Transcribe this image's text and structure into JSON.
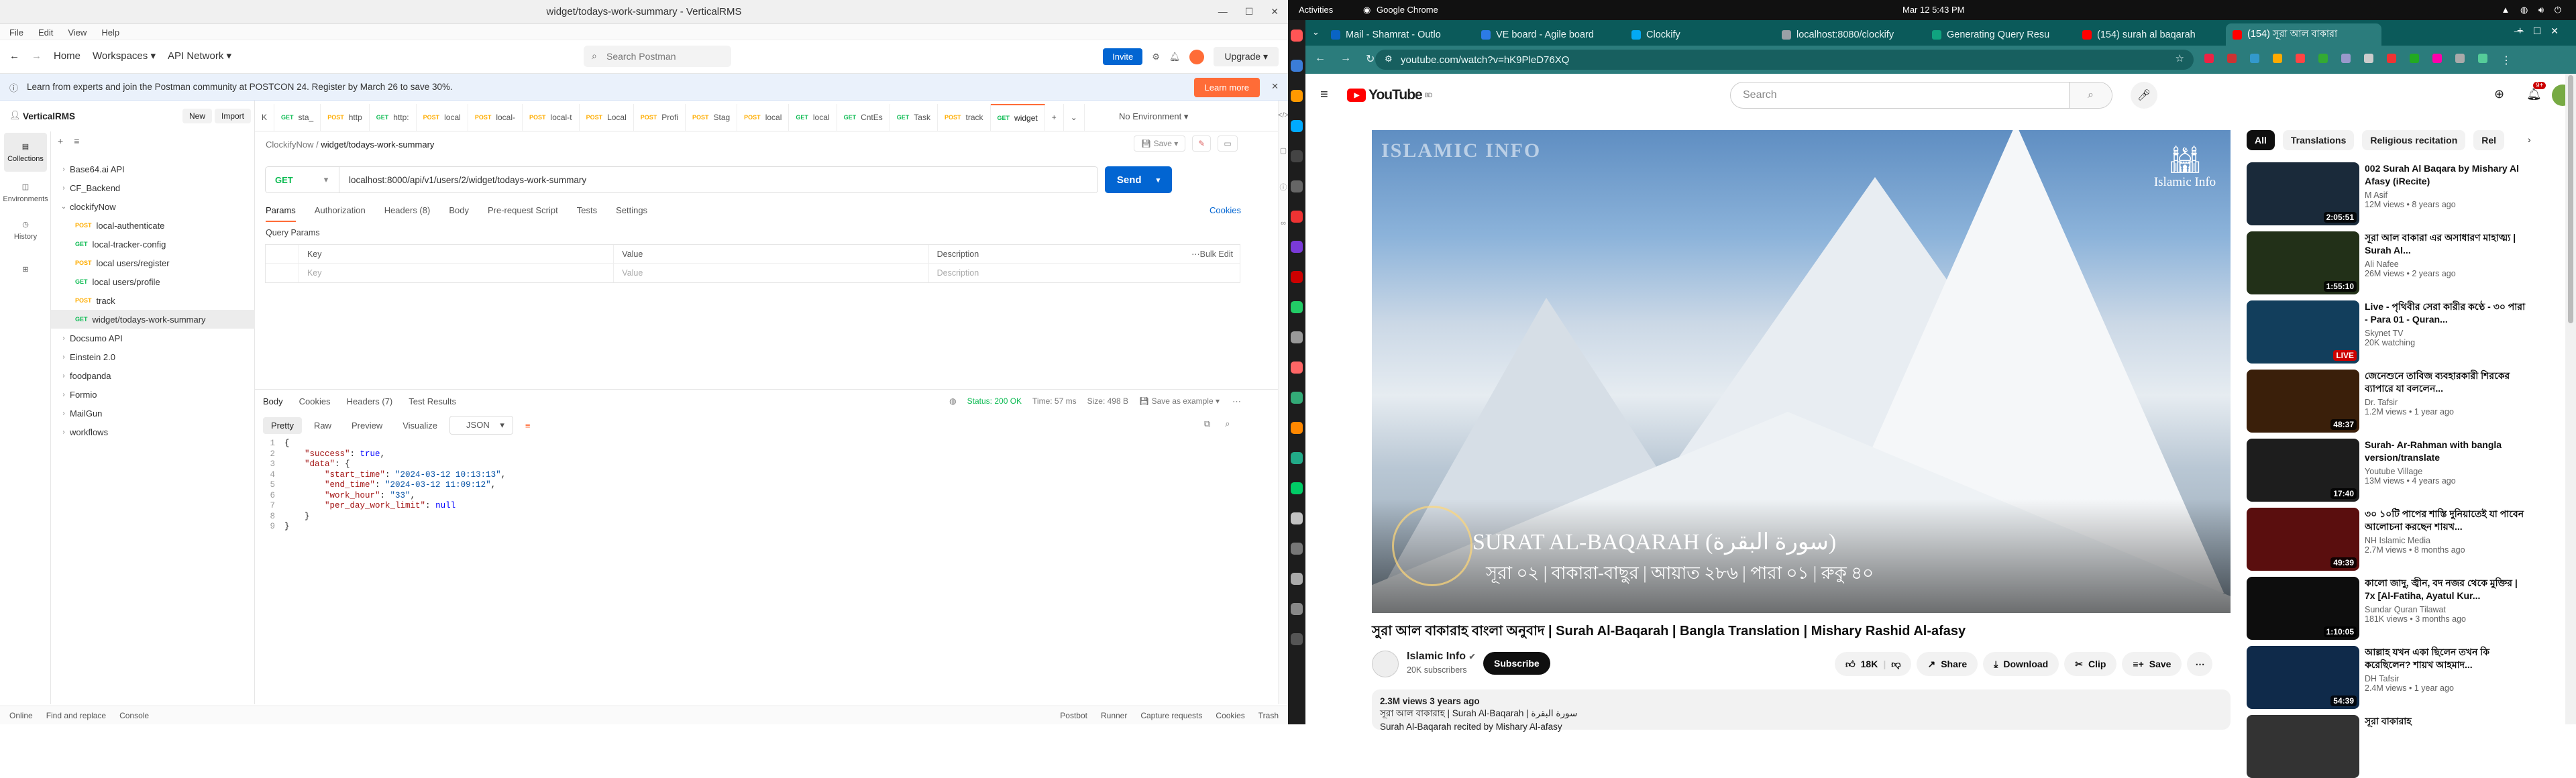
{
  "postman": {
    "window_title": "widget/todays-work-summary - VerticalRMS",
    "menu": [
      "File",
      "Edit",
      "View",
      "Help"
    ],
    "nav": {
      "home": "Home",
      "workspaces": "Workspaces",
      "api_network": "API Network"
    },
    "search_placeholder": "Search Postman",
    "invite": "Invite",
    "upgrade": "Upgrade",
    "banner_text": "Learn from experts and join the Postman community at POSTCON 24. Register by March 26 to save 30%.",
    "banner_button": "Learn more",
    "workspace_name": "VerticalRMS",
    "new_btn": "New",
    "import_btn": "Import",
    "rail": [
      "Collections",
      "Environments",
      "History"
    ],
    "tree": [
      {
        "label": "Base64.ai API",
        "type": "folder",
        "depth": 0
      },
      {
        "label": "CF_Backend",
        "type": "folder",
        "depth": 0
      },
      {
        "label": "clockifyNow",
        "type": "folder-open",
        "depth": 0
      },
      {
        "label": "local-authenticate",
        "type": "POST",
        "depth": 1
      },
      {
        "label": "local-tracker-config",
        "type": "GET",
        "depth": 1
      },
      {
        "label": "local users/register",
        "type": "POST",
        "depth": 1
      },
      {
        "label": "local users/profile",
        "type": "GET",
        "depth": 1
      },
      {
        "label": "track",
        "type": "POST",
        "depth": 1
      },
      {
        "label": "widget/todays-work-summary",
        "type": "GET",
        "depth": 1,
        "active": true
      },
      {
        "label": "Docsumo API",
        "type": "folder",
        "depth": 0
      },
      {
        "label": "Einstein 2.0",
        "type": "folder",
        "depth": 0
      },
      {
        "label": "foodpanda",
        "type": "folder",
        "depth": 0
      },
      {
        "label": "Formio",
        "type": "folder",
        "depth": 0
      },
      {
        "label": "MailGun",
        "type": "folder",
        "depth": 0
      },
      {
        "label": "workflows",
        "type": "folder",
        "depth": 0
      }
    ],
    "tabs": [
      {
        "m": "",
        "label": "K"
      },
      {
        "m": "GET",
        "label": "sta_"
      },
      {
        "m": "POST",
        "label": "http"
      },
      {
        "m": "GET",
        "label": "http:"
      },
      {
        "m": "POST",
        "label": "local"
      },
      {
        "m": "POST",
        "label": "local-"
      },
      {
        "m": "POST",
        "label": "local-t"
      },
      {
        "m": "POST",
        "label": "Local"
      },
      {
        "m": "POST",
        "label": "Profi"
      },
      {
        "m": "POST",
        "label": "Stag"
      },
      {
        "m": "POST",
        "label": "local"
      },
      {
        "m": "GET",
        "label": "local"
      },
      {
        "m": "GET",
        "label": "CntEs"
      },
      {
        "m": "GET",
        "label": "Task"
      },
      {
        "m": "POST",
        "label": "track"
      },
      {
        "m": "GET",
        "label": "widget",
        "active": true
      }
    ],
    "environment": "No Environment",
    "breadcrumb_parent": "ClockifyNow",
    "breadcrumb_current": "widget/todays-work-summary",
    "save_label": "Save",
    "method": "GET",
    "url": "localhost:8000/api/v1/users/2/widget/todays-work-summary",
    "send": "Send",
    "request_tabs": [
      "Params",
      "Authorization",
      "Headers (8)",
      "Body",
      "Pre-request Script",
      "Tests",
      "Settings"
    ],
    "cookies": "Cookies",
    "query_params": "Query Params",
    "param_headers": [
      "Key",
      "Value",
      "Description",
      "Bulk Edit"
    ],
    "param_placeholders": [
      "Key",
      "Value",
      "Description"
    ],
    "response_tabs": [
      "Body",
      "Cookies",
      "Headers (7)",
      "Test Results"
    ],
    "status": "Status: 200 OK",
    "time": "Time: 57 ms",
    "size": "Size: 498 B",
    "save_example": "Save as example",
    "body_modes": [
      "Pretty",
      "Raw",
      "Preview",
      "Visualize"
    ],
    "body_format": "JSON",
    "code_lines": [
      "{",
      "    \"success\": true,",
      "    \"data\": {",
      "        \"start_time\": \"2024-03-12 10:13:13\",",
      "        \"end_time\": \"2024-03-12 11:09:12\",",
      "        \"work_hour\": \"33\",",
      "        \"per_day_work_limit\": null",
      "    }",
      "}"
    ],
    "status_left": [
      "Online",
      "Find and replace",
      "Console"
    ],
    "status_right": [
      "Postbot",
      "Runner",
      "Capture requests",
      "Cookies",
      "Trash"
    ]
  },
  "desktop": {
    "activities": "Activities",
    "app": "Google Chrome",
    "clock": "Mar 12  5:43 PM"
  },
  "chrome": {
    "tabs": [
      {
        "label": "Mail - Shamrat - Outlo",
        "color": "#0a64c4"
      },
      {
        "label": "VE board - Agile board",
        "color": "#2c7be5"
      },
      {
        "label": "Clockify",
        "color": "#03a9f4"
      },
      {
        "label": "localhost:8080/clockify",
        "color": "#9aa0a6"
      },
      {
        "label": "Generating Query Resu",
        "color": "#10a37f"
      },
      {
        "label": "(154) surah al baqarah",
        "color": "#ff0000"
      },
      {
        "label": "(154) সূরা আল বাকারা",
        "color": "#ff0000",
        "active": true
      }
    ],
    "url": "youtube.com/watch?v=hK9PleD76XQ"
  },
  "youtube": {
    "logo": "YouTube",
    "logo_country": "BD",
    "search_placeholder": "Search",
    "notif_count": "9+",
    "overlay_brand": "ISLAMIC INFO",
    "overlay_badge": "Islamic Info",
    "overlay_title": "SURAT AL-BAQARAH (سورة البقرة)",
    "overlay_sub": "সূরা ০২ | বাকারা-বাছুর | আয়াত ২৮৬ | পারা ০১ | রুকু ৪০",
    "title": "সুরা আল বাকারাহ বাংলা অনুবাদ | Surah Al-Baqarah | Bangla Translation | Mishary Rashid Al-afasy",
    "channel": "Islamic Info",
    "subs": "20K subscribers",
    "subscribe": "Subscribe",
    "likes": "18K",
    "actions": [
      "Share",
      "Download",
      "Clip",
      "Save"
    ],
    "desc_meta": "2.3M views  3 years ago",
    "desc_line1": "সূরা আল বাকারাহ | Surah Al-Baqarah | سورة البقرة",
    "desc_line2": "Surah Al-Baqarah recited by Mishary Al-afasy",
    "chips": [
      "All",
      "Translations",
      "Religious recitation",
      "Rel"
    ],
    "recs": [
      {
        "title": "002 Surah Al Baqara by Mishary Al Afasy (iRecite)",
        "channel": "M Asif",
        "views": "12M views • 8 years ago",
        "dur": "2:05:51",
        "bg": "#1a2a3a"
      },
      {
        "title": "সূরা আল বাকারা এর অসাধারণ মাহাত্ম্য | Surah Al...",
        "channel": "Ali Nafee",
        "views": "26M views • 2 years ago",
        "dur": "1:55:10",
        "bg": "#223018"
      },
      {
        "title": "Live - পৃথিবীর সেরা কারীর কণ্ঠে - ৩০ পারা - Para 01 - Quran...",
        "channel": "Skynet TV",
        "views": "20K watching",
        "dur": "LIVE",
        "bg": "#123e5c"
      },
      {
        "title": "জেনেশুনে তাবিজ ব্যবহারকারী শিরকের ব্যাপারে যা বললেন...",
        "channel": "Dr. Tafsir",
        "views": "1.2M views • 1 year ago",
        "dur": "48:37",
        "bg": "#3a1f0a"
      },
      {
        "title": "Surah- Ar-Rahman with bangla version/translate",
        "channel": "Youtube Village",
        "views": "13M views • 4 years ago",
        "dur": "17:40",
        "bg": "#1d1d1d"
      },
      {
        "title": "৩০ ১০টি পাপের শাস্তি দুনিয়াতেই যা পাবেন আলোচনা করছেন শায়খ...",
        "channel": "NH Islamic Media",
        "views": "2.7M views • 8 months ago",
        "dur": "49:39",
        "bg": "#5a0e0e"
      },
      {
        "title": "কালো জাদু, জ্বীন, বদ নজর থেকে মুক্তির | 7x [Al-Fatiha, Ayatul Kur...",
        "channel": "Sundar Quran Tilawat",
        "views": "181K views • 3 months ago",
        "dur": "1:10:05",
        "bg": "#0d0d0d"
      },
      {
        "title": "আল্লাহ যখন একা ছিলেন তখন কি করেছিলেন? শায়খ আহমাদ...",
        "channel": "DH Tafsir",
        "views": "2.4M views • 1 year ago",
        "dur": "54:39",
        "bg": "#0f2a4a"
      },
      {
        "title": "সূরা বাকারাহ",
        "channel": "",
        "views": "",
        "dur": "",
        "bg": "#333"
      }
    ]
  }
}
